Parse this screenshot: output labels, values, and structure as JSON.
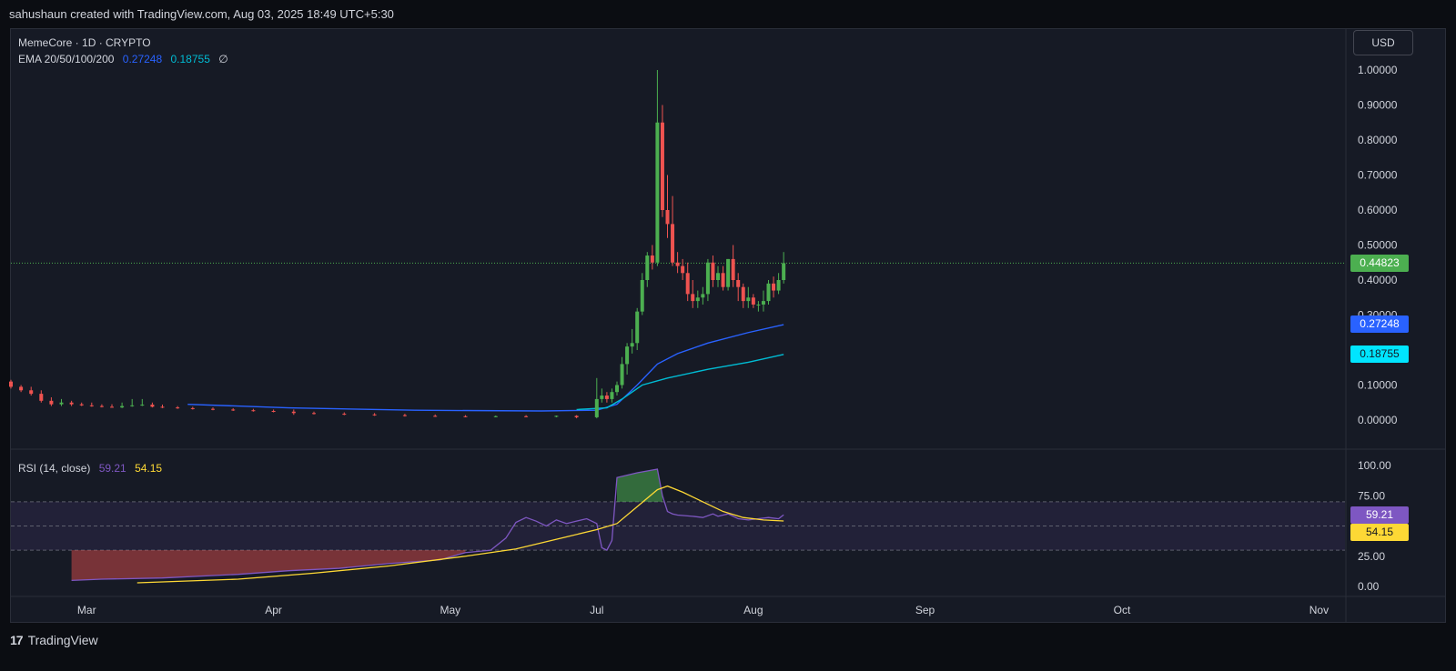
{
  "header": {
    "attribution": "sahushaun created with TradingView.com, Aug 03, 2025 18:49 UTC+5:30"
  },
  "legend": {
    "symbol": "MemeCore · 1D · CRYPTO",
    "ema_label": "EMA 20/50/100/200",
    "ema_value_1": "0.27248",
    "ema_value_2": "0.18755",
    "ema_value_3": "∅",
    "rsi_label": "RSI (14, close)",
    "rsi_value": "59.21",
    "rsi_ma_value": "54.15"
  },
  "currency_button": "USD",
  "badges": {
    "last_price": "0.44823",
    "ema_a": "0.27248",
    "ema_b": "0.18755",
    "rsi": "59.21",
    "rsi_ma": "54.15"
  },
  "footer": {
    "brand": "TradingView",
    "logo_mark": "17"
  },
  "colors": {
    "up": "#26a69a",
    "up_candle": "#4caf50",
    "down": "#ef5350",
    "ema_blue": "#2962ff",
    "ema_cyan": "#00bcd4",
    "rsi_line": "#7e57c2",
    "rsi_ma": "#fdd835",
    "price_line": "#4caf50"
  },
  "chart_data": [
    {
      "type": "candlestick",
      "title": "MemeCore · 1D · CRYPTO",
      "ylim": [
        0,
        1.0
      ],
      "y_ticks": [
        "1.00000",
        "0.90000",
        "0.80000",
        "0.70000",
        "0.60000",
        "0.50000",
        "0.40000",
        "0.30000",
        "0.10000",
        "0.00000"
      ],
      "x_ticks": [
        "Mar",
        "Apr",
        "May",
        "Jul",
        "Aug",
        "Sep",
        "Oct",
        "Nov"
      ],
      "last_price": 0.44823,
      "candles": [
        {
          "day": 0,
          "o": 0.11,
          "h": 0.115,
          "l": 0.09,
          "c": 0.095
        },
        {
          "day": 2,
          "o": 0.095,
          "h": 0.1,
          "l": 0.08,
          "c": 0.085
        },
        {
          "day": 4,
          "o": 0.085,
          "h": 0.095,
          "l": 0.07,
          "c": 0.075
        },
        {
          "day": 6,
          "o": 0.075,
          "h": 0.085,
          "l": 0.05,
          "c": 0.055
        },
        {
          "day": 8,
          "o": 0.055,
          "h": 0.065,
          "l": 0.04,
          "c": 0.045
        },
        {
          "day": 10,
          "o": 0.045,
          "h": 0.06,
          "l": 0.04,
          "c": 0.05
        },
        {
          "day": 12,
          "o": 0.05,
          "h": 0.055,
          "l": 0.04,
          "c": 0.045
        },
        {
          "day": 14,
          "o": 0.045,
          "h": 0.05,
          "l": 0.04,
          "c": 0.042
        },
        {
          "day": 16,
          "o": 0.042,
          "h": 0.05,
          "l": 0.038,
          "c": 0.04
        },
        {
          "day": 18,
          "o": 0.04,
          "h": 0.045,
          "l": 0.036,
          "c": 0.038
        },
        {
          "day": 20,
          "o": 0.038,
          "h": 0.045,
          "l": 0.035,
          "c": 0.036
        },
        {
          "day": 22,
          "o": 0.036,
          "h": 0.05,
          "l": 0.034,
          "c": 0.04
        },
        {
          "day": 24,
          "o": 0.04,
          "h": 0.06,
          "l": 0.038,
          "c": 0.042
        },
        {
          "day": 26,
          "o": 0.042,
          "h": 0.06,
          "l": 0.04,
          "c": 0.044
        },
        {
          "day": 28,
          "o": 0.044,
          "h": 0.05,
          "l": 0.036,
          "c": 0.038
        },
        {
          "day": 30,
          "o": 0.038,
          "h": 0.044,
          "l": 0.034,
          "c": 0.036
        },
        {
          "day": 33,
          "o": 0.036,
          "h": 0.04,
          "l": 0.032,
          "c": 0.034
        },
        {
          "day": 36,
          "o": 0.034,
          "h": 0.038,
          "l": 0.03,
          "c": 0.032
        },
        {
          "day": 40,
          "o": 0.032,
          "h": 0.036,
          "l": 0.028,
          "c": 0.03
        },
        {
          "day": 44,
          "o": 0.03,
          "h": 0.034,
          "l": 0.026,
          "c": 0.028
        },
        {
          "day": 48,
          "o": 0.028,
          "h": 0.032,
          "l": 0.024,
          "c": 0.026
        },
        {
          "day": 52,
          "o": 0.026,
          "h": 0.03,
          "l": 0.022,
          "c": 0.024
        },
        {
          "day": 56,
          "o": 0.024,
          "h": 0.03,
          "l": 0.015,
          "c": 0.02
        },
        {
          "day": 60,
          "o": 0.02,
          "h": 0.024,
          "l": 0.016,
          "c": 0.018
        },
        {
          "day": 66,
          "o": 0.018,
          "h": 0.022,
          "l": 0.014,
          "c": 0.016
        },
        {
          "day": 72,
          "o": 0.016,
          "h": 0.02,
          "l": 0.012,
          "c": 0.014
        },
        {
          "day": 78,
          "o": 0.014,
          "h": 0.018,
          "l": 0.01,
          "c": 0.012
        },
        {
          "day": 84,
          "o": 0.012,
          "h": 0.016,
          "l": 0.009,
          "c": 0.011
        },
        {
          "day": 90,
          "o": 0.011,
          "h": 0.014,
          "l": 0.008,
          "c": 0.01
        },
        {
          "day": 96,
          "o": 0.01,
          "h": 0.013,
          "l": 0.008,
          "c": 0.011
        },
        {
          "day": 102,
          "o": 0.011,
          "h": 0.014,
          "l": 0.008,
          "c": 0.01
        },
        {
          "day": 108,
          "o": 0.01,
          "h": 0.013,
          "l": 0.008,
          "c": 0.012
        },
        {
          "day": 112,
          "o": 0.012,
          "h": 0.014,
          "l": 0.005,
          "c": 0.008
        },
        {
          "day": 116,
          "o": 0.008,
          "h": 0.12,
          "l": 0.005,
          "c": 0.06
        },
        {
          "day": 117,
          "o": 0.06,
          "h": 0.09,
          "l": 0.05,
          "c": 0.07
        },
        {
          "day": 118,
          "o": 0.07,
          "h": 0.08,
          "l": 0.05,
          "c": 0.06
        },
        {
          "day": 119,
          "o": 0.06,
          "h": 0.09,
          "l": 0.05,
          "c": 0.08
        },
        {
          "day": 120,
          "o": 0.08,
          "h": 0.11,
          "l": 0.07,
          "c": 0.1
        },
        {
          "day": 121,
          "o": 0.1,
          "h": 0.18,
          "l": 0.09,
          "c": 0.16
        },
        {
          "day": 122,
          "o": 0.16,
          "h": 0.22,
          "l": 0.13,
          "c": 0.21
        },
        {
          "day": 123,
          "o": 0.21,
          "h": 0.26,
          "l": 0.19,
          "c": 0.22
        },
        {
          "day": 124,
          "o": 0.22,
          "h": 0.32,
          "l": 0.2,
          "c": 0.31
        },
        {
          "day": 125,
          "o": 0.31,
          "h": 0.42,
          "l": 0.3,
          "c": 0.4
        },
        {
          "day": 126,
          "o": 0.4,
          "h": 0.48,
          "l": 0.38,
          "c": 0.47
        },
        {
          "day": 127,
          "o": 0.47,
          "h": 0.5,
          "l": 0.43,
          "c": 0.45
        },
        {
          "day": 128,
          "o": 0.45,
          "h": 1.0,
          "l": 0.44,
          "c": 0.85
        },
        {
          "day": 129,
          "o": 0.85,
          "h": 0.9,
          "l": 0.58,
          "c": 0.6
        },
        {
          "day": 130,
          "o": 0.6,
          "h": 0.7,
          "l": 0.52,
          "c": 0.56
        },
        {
          "day": 131,
          "o": 0.56,
          "h": 0.64,
          "l": 0.44,
          "c": 0.45
        },
        {
          "day": 132,
          "o": 0.45,
          "h": 0.48,
          "l": 0.42,
          "c": 0.44
        },
        {
          "day": 133,
          "o": 0.44,
          "h": 0.46,
          "l": 0.4,
          "c": 0.42
        },
        {
          "day": 134,
          "o": 0.42,
          "h": 0.45,
          "l": 0.34,
          "c": 0.36
        },
        {
          "day": 135,
          "o": 0.36,
          "h": 0.4,
          "l": 0.32,
          "c": 0.34
        },
        {
          "day": 136,
          "o": 0.34,
          "h": 0.37,
          "l": 0.32,
          "c": 0.35
        },
        {
          "day": 137,
          "o": 0.35,
          "h": 0.38,
          "l": 0.33,
          "c": 0.36
        },
        {
          "day": 138,
          "o": 0.36,
          "h": 0.46,
          "l": 0.34,
          "c": 0.45
        },
        {
          "day": 139,
          "o": 0.45,
          "h": 0.47,
          "l": 0.38,
          "c": 0.4
        },
        {
          "day": 140,
          "o": 0.4,
          "h": 0.44,
          "l": 0.38,
          "c": 0.42
        },
        {
          "day": 141,
          "o": 0.42,
          "h": 0.44,
          "l": 0.37,
          "c": 0.38
        },
        {
          "day": 142,
          "o": 0.38,
          "h": 0.46,
          "l": 0.37,
          "c": 0.46
        },
        {
          "day": 143,
          "o": 0.46,
          "h": 0.5,
          "l": 0.38,
          "c": 0.4
        },
        {
          "day": 144,
          "o": 0.4,
          "h": 0.42,
          "l": 0.34,
          "c": 0.38
        },
        {
          "day": 145,
          "o": 0.38,
          "h": 0.39,
          "l": 0.32,
          "c": 0.34
        },
        {
          "day": 146,
          "o": 0.34,
          "h": 0.38,
          "l": 0.32,
          "c": 0.35
        },
        {
          "day": 147,
          "o": 0.35,
          "h": 0.36,
          "l": 0.32,
          "c": 0.33
        },
        {
          "day": 148,
          "o": 0.33,
          "h": 0.34,
          "l": 0.31,
          "c": 0.33
        },
        {
          "day": 149,
          "o": 0.33,
          "h": 0.37,
          "l": 0.31,
          "c": 0.34
        },
        {
          "day": 150,
          "o": 0.34,
          "h": 0.4,
          "l": 0.33,
          "c": 0.39
        },
        {
          "day": 151,
          "o": 0.39,
          "h": 0.41,
          "l": 0.35,
          "c": 0.37
        },
        {
          "day": 152,
          "o": 0.37,
          "h": 0.42,
          "l": 0.36,
          "c": 0.4
        },
        {
          "day": 153,
          "o": 0.4,
          "h": 0.48,
          "l": 0.39,
          "c": 0.44823
        }
      ],
      "series": [
        {
          "name": "EMA 20",
          "values": [
            [
              35,
              0.045
            ],
            [
              55,
              0.035
            ],
            [
              80,
              0.028
            ],
            [
              105,
              0.026
            ],
            [
              116,
              0.028
            ],
            [
              120,
              0.045
            ],
            [
              124,
              0.1
            ],
            [
              128,
              0.16
            ],
            [
              132,
              0.19
            ],
            [
              138,
              0.22
            ],
            [
              146,
              0.25
            ],
            [
              153,
              0.27248
            ]
          ]
        },
        {
          "name": "EMA 50",
          "values": [
            [
              112,
              0.03
            ],
            [
              118,
              0.035
            ],
            [
              121,
              0.06
            ],
            [
              125,
              0.1
            ],
            [
              130,
              0.12
            ],
            [
              138,
              0.145
            ],
            [
              146,
              0.165
            ],
            [
              153,
              0.18755
            ]
          ]
        }
      ]
    },
    {
      "type": "line",
      "title": "RSI (14, close)",
      "ylim": [
        0,
        100
      ],
      "y_ticks": [
        "100.00",
        "75.00",
        "25.00",
        "0.00"
      ],
      "bands": [
        30,
        50,
        70
      ],
      "series": [
        {
          "name": "RSI",
          "values": [
            [
              12,
              5
            ],
            [
              18,
              6
            ],
            [
              30,
              7
            ],
            [
              45,
              10
            ],
            [
              55,
              13
            ],
            [
              65,
              15
            ],
            [
              75,
              19
            ],
            [
              85,
              22
            ],
            [
              90,
              28
            ],
            [
              95,
              30
            ],
            [
              98,
              40
            ],
            [
              100,
              53
            ],
            [
              102,
              57
            ],
            [
              104,
              54
            ],
            [
              106,
              50
            ],
            [
              108,
              55
            ],
            [
              110,
              52
            ],
            [
              112,
              54
            ],
            [
              114,
              56
            ],
            [
              116,
              52
            ],
            [
              117,
              32
            ],
            [
              118,
              30
            ],
            [
              119,
              38
            ],
            [
              120,
              90
            ],
            [
              124,
              94
            ],
            [
              128,
              97
            ],
            [
              129,
              75
            ],
            [
              130,
              62
            ],
            [
              131,
              60
            ],
            [
              132,
              59
            ],
            [
              135,
              58
            ],
            [
              137,
              57
            ],
            [
              139,
              60
            ],
            [
              140,
              58
            ],
            [
              142,
              60
            ],
            [
              144,
              56
            ],
            [
              146,
              55
            ],
            [
              148,
              56
            ],
            [
              150,
              57
            ],
            [
              152,
              56
            ],
            [
              153,
              59.21
            ]
          ]
        },
        {
          "name": "RSI MA",
          "values": [
            [
              25,
              3
            ],
            [
              45,
              6
            ],
            [
              60,
              11
            ],
            [
              75,
              17
            ],
            [
              90,
              25
            ],
            [
              100,
              31
            ],
            [
              110,
              41
            ],
            [
              116,
              47
            ],
            [
              120,
              52
            ],
            [
              124,
              66
            ],
            [
              128,
              80
            ],
            [
              130,
              83
            ],
            [
              133,
              78
            ],
            [
              137,
              70
            ],
            [
              141,
              62
            ],
            [
              145,
              57
            ],
            [
              149,
              55
            ],
            [
              153,
              54.15
            ]
          ]
        }
      ]
    }
  ]
}
